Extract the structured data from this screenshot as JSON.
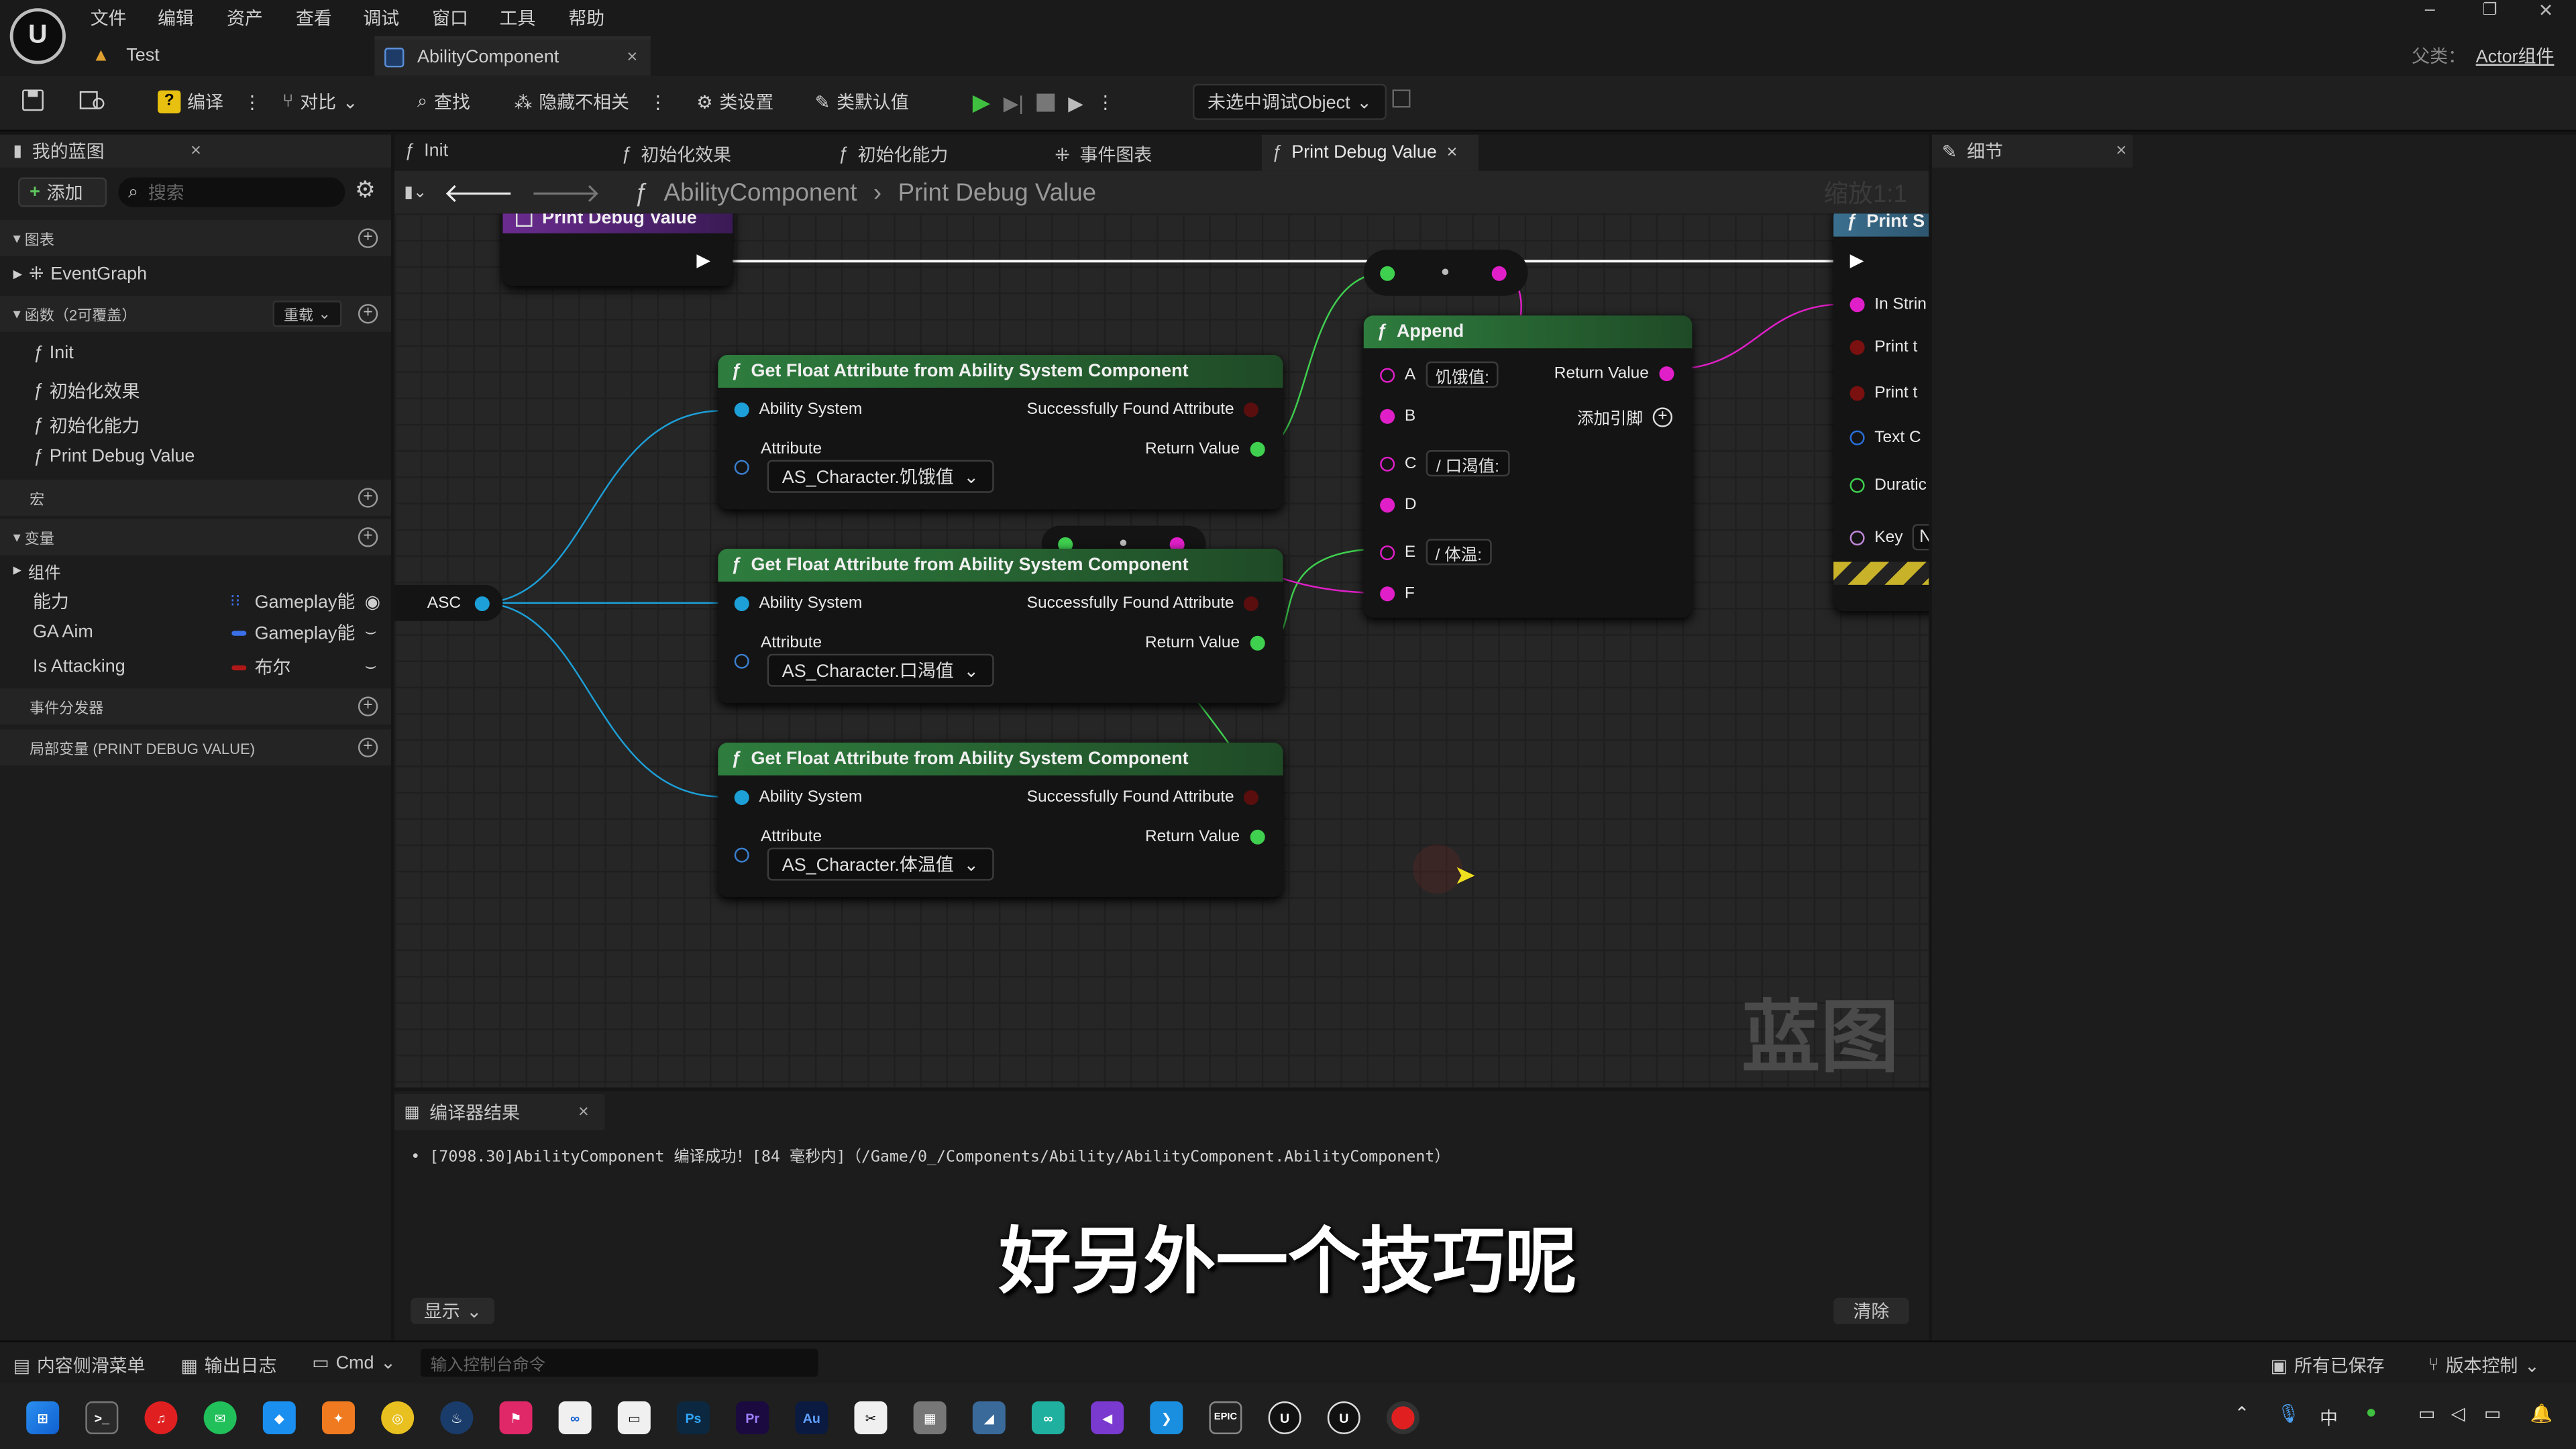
{
  "menu": {
    "items": [
      "文件",
      "编辑",
      "资产",
      "查看",
      "调试",
      "窗口",
      "工具",
      "帮助"
    ],
    "parent_label": "父类：",
    "parent_value": "Actor组件"
  },
  "tabs": [
    {
      "label": "Test"
    },
    {
      "label": "AbilityComponent"
    }
  ],
  "toolbar": {
    "compile": "编译",
    "diff": "对比",
    "find": "查找",
    "hide_unrelated": "隐藏不相关",
    "class_settings": "类设置",
    "class_defaults": "类默认值",
    "debug_object": "未选中调试Object"
  },
  "left": {
    "panel_title": "我的蓝图",
    "add_label": "添加",
    "search_placeholder": "搜索",
    "sec_graphs": "图表",
    "event_graph": "EventGraph",
    "sec_functions": "函数（2可覆盖）",
    "override_label": "重载",
    "functions": [
      "Init",
      "初始化效果",
      "初始化能力",
      "Print Debug Value"
    ],
    "sec_macros": "宏",
    "sec_variables": "变量",
    "components": "组件",
    "variables": [
      {
        "name": "能力",
        "type": "Gameplay能",
        "color": "#3b6fe8"
      },
      {
        "name": "GA Aim",
        "type": "Gameplay能",
        "color": "#3b6fe8"
      },
      {
        "name": "Is Attacking",
        "type": "布尔",
        "color": "#b01818"
      }
    ],
    "sec_dispatchers": "事件分发器",
    "sec_locals": "局部变量 (PRINT DEBUG VALUE)"
  },
  "graph_tabs": [
    "Init",
    "初始化效果",
    "初始化能力",
    "事件图表",
    "Print Debug Value"
  ],
  "breadcrumb": {
    "root": "AbilityComponent",
    "current": "Print Debug Value",
    "zoom": "缩放1:1"
  },
  "nodes": {
    "entry_title": "Print Debug Value",
    "asc_label": "ASC",
    "get_title": "Get Float Attribute from Ability System Component",
    "ability_system": "Ability System",
    "found": "Successfully Found Attribute",
    "attribute": "Attribute",
    "return_value": "Return Value",
    "attrs": [
      "AS_Character.饥饿值",
      "AS_Character.口渴值",
      "AS_Character.体温值"
    ],
    "append_title": "Append",
    "append_pins": [
      "A",
      "B",
      "C",
      "D",
      "E",
      "F"
    ],
    "append_texts": [
      "饥饿值:",
      "/ 口渴值:",
      "/ 体温:"
    ],
    "add_pin": "添加引脚",
    "print_title": "Print S",
    "print_pins": [
      "In Strin",
      "Print t",
      "Print t",
      "Text C",
      "Duratic",
      "Key"
    ],
    "key_value": "N",
    "watermark": "蓝图"
  },
  "details": {
    "title": "细节"
  },
  "compiler": {
    "tab": "编译器结果",
    "log": "[7098.30]AbilityComponent 编译成功！[84 毫秒内]（/Game/0_/Components/Ability/AbilityComponent.AbilityComponent）",
    "show": "显示",
    "clear": "清除"
  },
  "subtitle": "好另外一个技巧呢",
  "status": {
    "drawer": "内容侧滑菜单",
    "output": "输出日志",
    "cmd": "Cmd",
    "console_placeholder": "输入控制台命令",
    "saved": "所有已保存",
    "source_control": "版本控制"
  },
  "taskbar": {
    "ime": "中"
  }
}
